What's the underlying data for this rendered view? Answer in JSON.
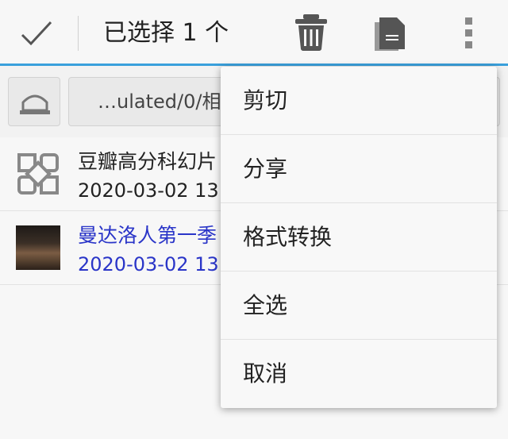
{
  "toolbar": {
    "title": "已选择 1 个",
    "accent_color": "#3aa0dc"
  },
  "path": {
    "text": "…ulated/0/相"
  },
  "files": [
    {
      "name": "豆瓣高分科幻片",
      "date": "2020-03-02 13",
      "icon": "folder-grid-icon",
      "selected": false
    },
    {
      "name": "曼达洛人第一季",
      "date": "2020-03-02 13",
      "icon": "video-thumbnail",
      "selected": true
    }
  ],
  "selected_text_color": "#2a35c8",
  "menu": {
    "items": [
      {
        "label": "剪切"
      },
      {
        "label": "分享"
      },
      {
        "label": "格式转换"
      },
      {
        "label": "全选"
      },
      {
        "label": "取消"
      }
    ]
  }
}
